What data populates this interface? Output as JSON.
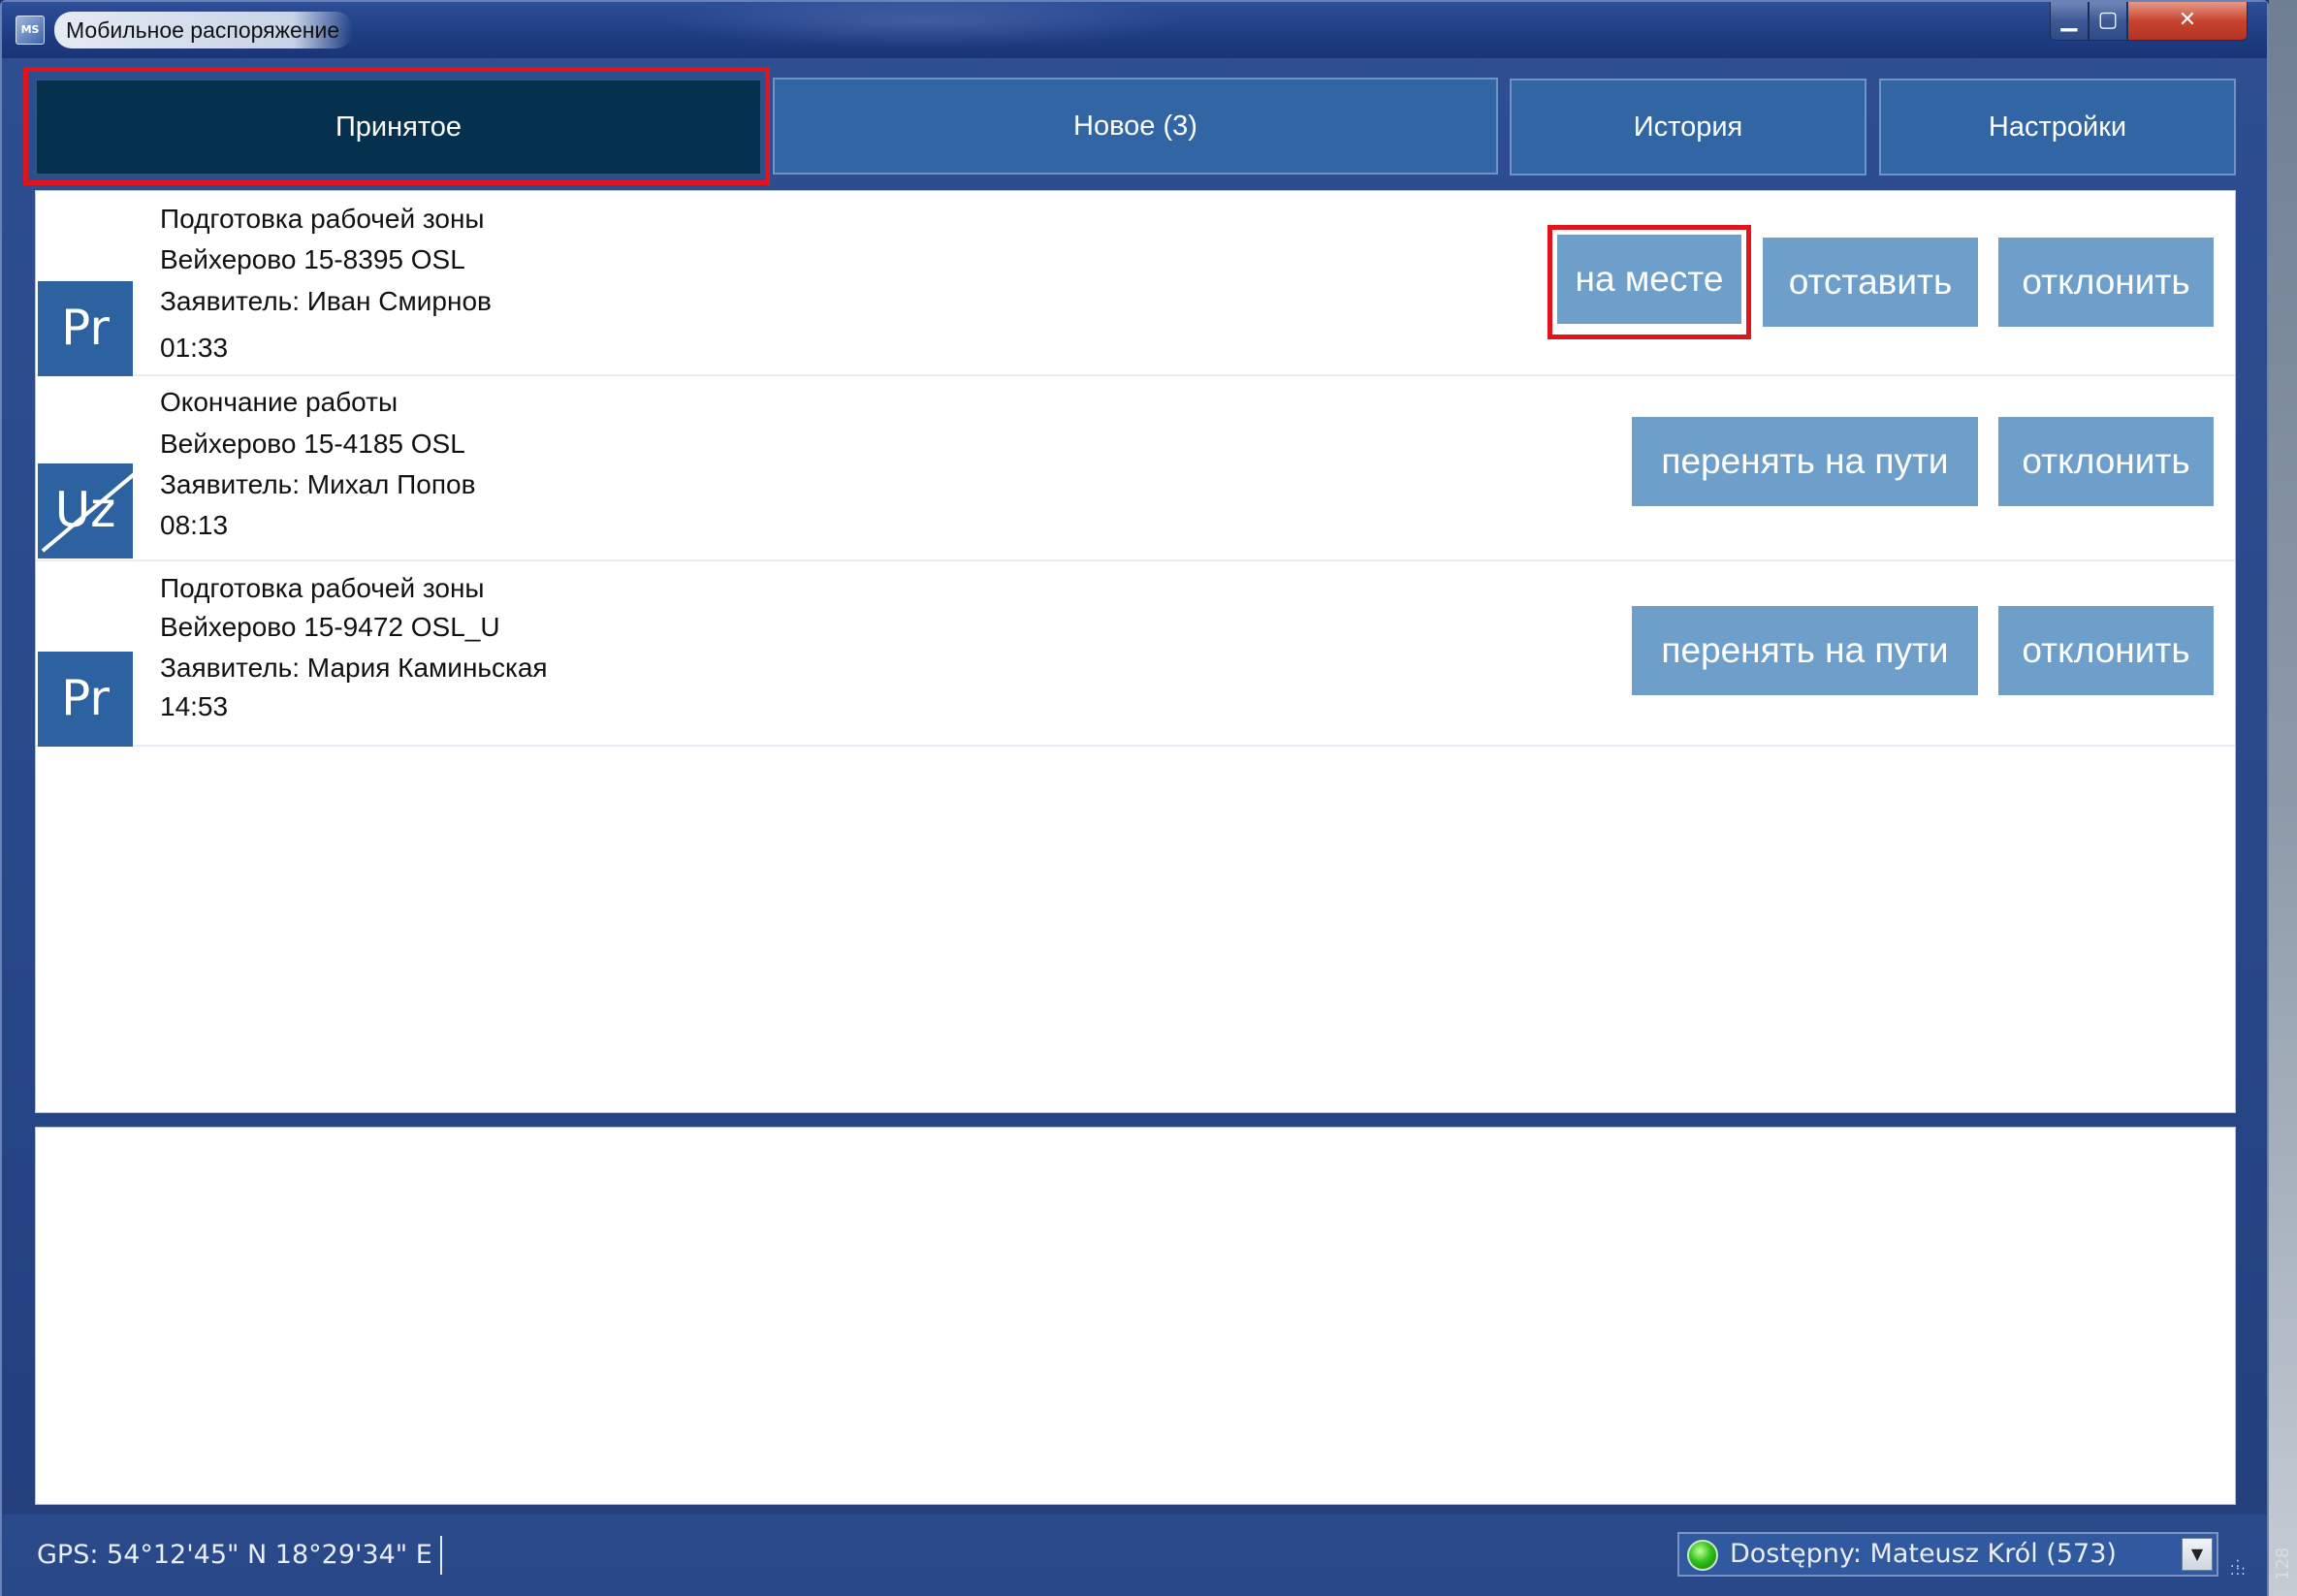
{
  "window": {
    "title": "Мобильное распоряжение",
    "app_icon": "MS"
  },
  "tabs": [
    {
      "label": "Принятое",
      "active": true
    },
    {
      "label": "Новое (3)",
      "active": false
    },
    {
      "label": "История",
      "active": false
    },
    {
      "label": "Настройки",
      "active": false
    }
  ],
  "orders": [
    {
      "type_code": "Pr",
      "title": "Подготовка рабочей зоны",
      "location": "Вейхерово 15-8395 OSL",
      "requester": "Заявитель: Иван Смирнов",
      "time": "01:33",
      "actions": [
        "на месте",
        "отставить",
        "отклонить"
      ]
    },
    {
      "type_code": "Uz",
      "title": "Окончание работы",
      "location": "Вейхерово 15-4185 OSL",
      "requester": "Заявитель: Михал Попов",
      "time": "08:13",
      "actions": [
        "перенять на пути",
        "отклонить"
      ]
    },
    {
      "type_code": "Pr",
      "title": "Подготовка рабочей зоны",
      "location": "Вейхерово 15-9472 OSL_U",
      "requester": "Заявитель: Мария Каминьская",
      "time": "14:53",
      "actions": [
        "перенять на пути",
        "отклонить"
      ]
    }
  ],
  "status": {
    "gps": "GPS: 54°12'45\" N  18°29'34\" E",
    "user": "Dostępny: Mateusz Król (573)",
    "user_state_color": "#2fc21c"
  },
  "edge_mark": "128",
  "colors": {
    "active_tab": "#05314f",
    "tab": "#3265a4",
    "action_button": "#6e9fca",
    "badge": "#2c62a0",
    "highlight": "#e0151b"
  }
}
